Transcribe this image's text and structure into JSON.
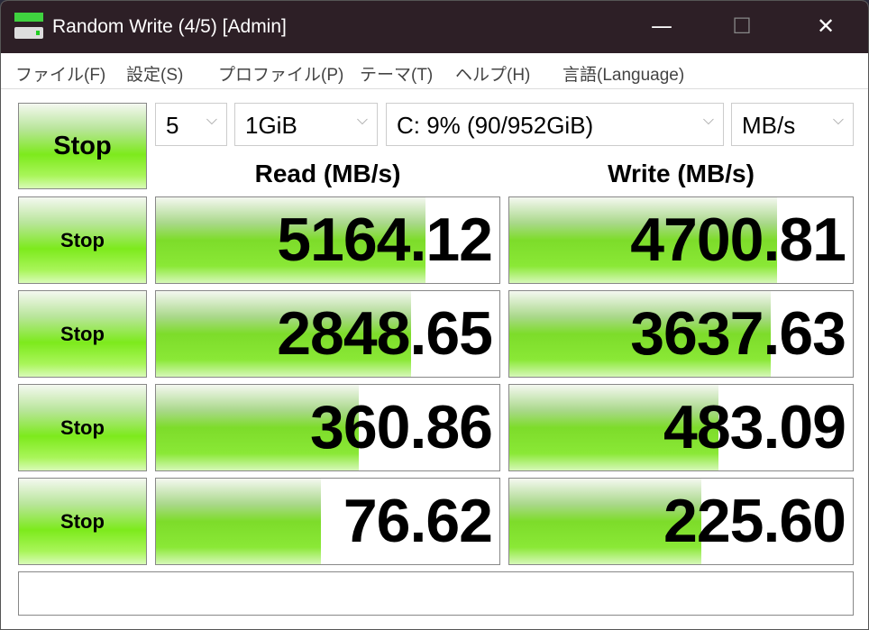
{
  "window": {
    "title": "Random Write (4/5) [Admin]",
    "minimize": "—",
    "maximize": "☐",
    "close": "✕"
  },
  "menu": [
    "ファイル(F)",
    "設定(S)",
    "プロファイル(P)",
    "テーマ(T)",
    "ヘルプ(H)",
    "言語(Language)"
  ],
  "controls": {
    "all_button": "Stop",
    "count": "5",
    "size": "1GiB",
    "drive": "C: 9% (90/952GiB)",
    "unit": "MB/s",
    "chevron": "⌵"
  },
  "headers": {
    "read": "Read (MB/s)",
    "write": "Write (MB/s)"
  },
  "rows": [
    {
      "button": "Stop",
      "read": "5164.12",
      "write": "4700.81",
      "read_fill": 0.785,
      "write_fill": 0.78
    },
    {
      "button": "Stop",
      "read": "2848.65",
      "write": "3637.63",
      "read_fill": 0.743,
      "write_fill": 0.76
    },
    {
      "button": "Stop",
      "read": "360.86",
      "write": "483.09",
      "read_fill": 0.59,
      "write_fill": 0.61
    },
    {
      "button": "Stop",
      "read": "76.62",
      "write": "225.60",
      "read_fill": 0.48,
      "write_fill": 0.56
    }
  ],
  "comment": ""
}
